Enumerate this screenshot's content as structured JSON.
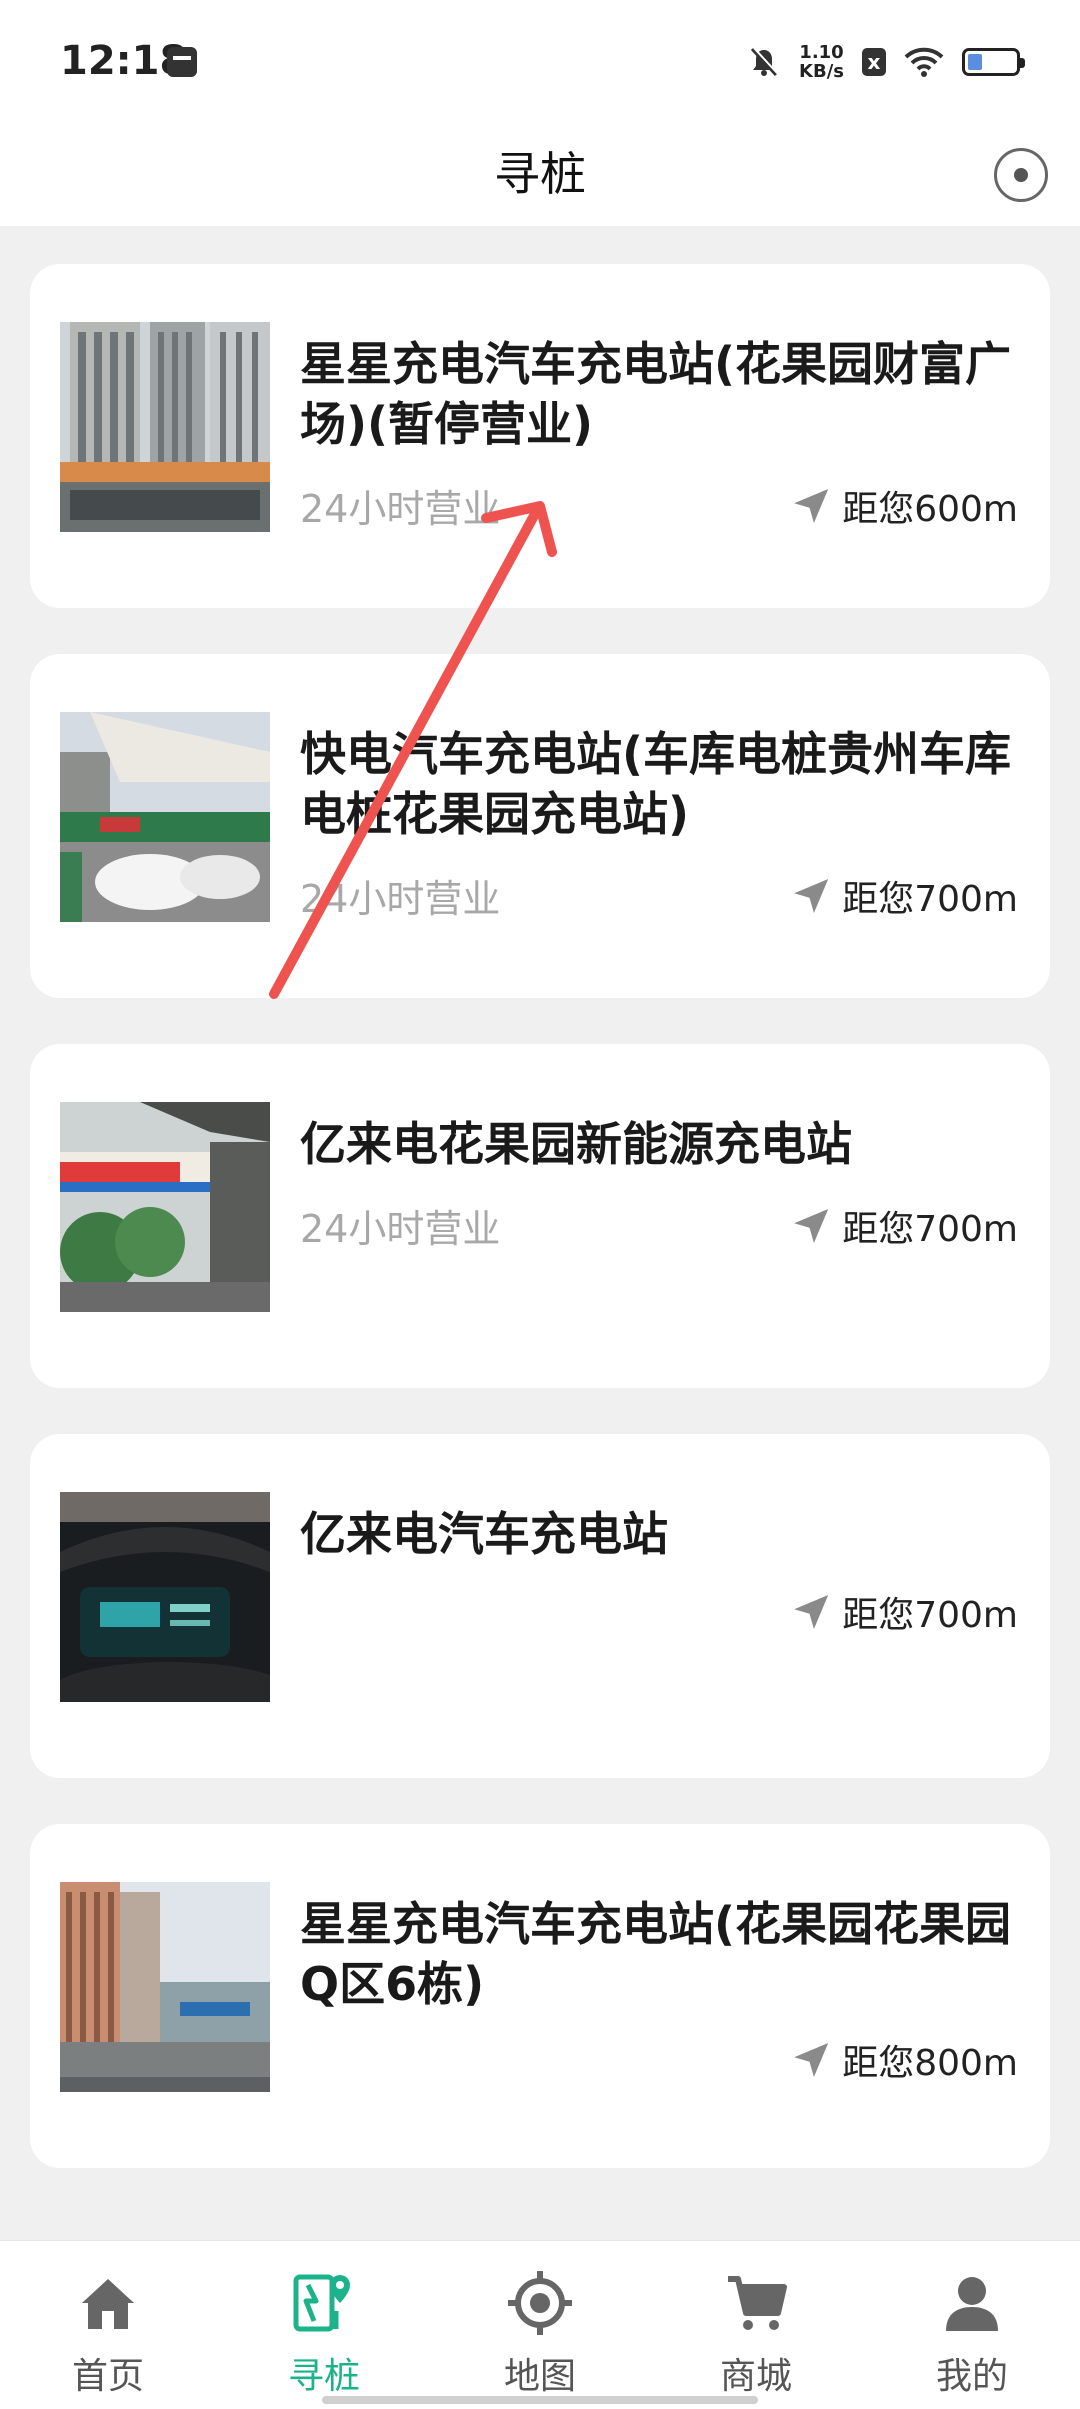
{
  "status_bar": {
    "time": "12:18",
    "net_speed_value": "1.10",
    "net_speed_unit": "KB/s",
    "sim_badge": "x",
    "battery_level": 0.3
  },
  "header": {
    "title": "寻桩"
  },
  "stations": [
    {
      "name": "星星充电汽车充电站(花果园财富广场)(暂停营业)",
      "hours": "24小时营业",
      "distance": "距您600m"
    },
    {
      "name": "快电汽车充电站(车库电桩贵州车库电桩花果园充电站)",
      "hours": "24小时营业",
      "distance": "距您700m"
    },
    {
      "name": "亿来电花果园新能源充电站",
      "hours": "24小时营业",
      "distance": "距您700m"
    },
    {
      "name": "亿来电汽车充电站",
      "hours": "",
      "distance": "距您700m"
    },
    {
      "name": "星星充电汽车充电站(花果园花果园Q区6栋)",
      "hours": "",
      "distance": "距您800m"
    }
  ],
  "tabbar": {
    "tabs": [
      {
        "label": "首页",
        "icon": "home-icon"
      },
      {
        "label": "寻桩",
        "icon": "charging-pile-icon",
        "active": true
      },
      {
        "label": "地图",
        "icon": "map-target-icon"
      },
      {
        "label": "商城",
        "icon": "cart-icon"
      },
      {
        "label": "我的",
        "icon": "user-icon"
      }
    ]
  },
  "colors": {
    "accent": "#1cb38a",
    "annotation": "#ef5350",
    "background": "#f0f0f0"
  }
}
